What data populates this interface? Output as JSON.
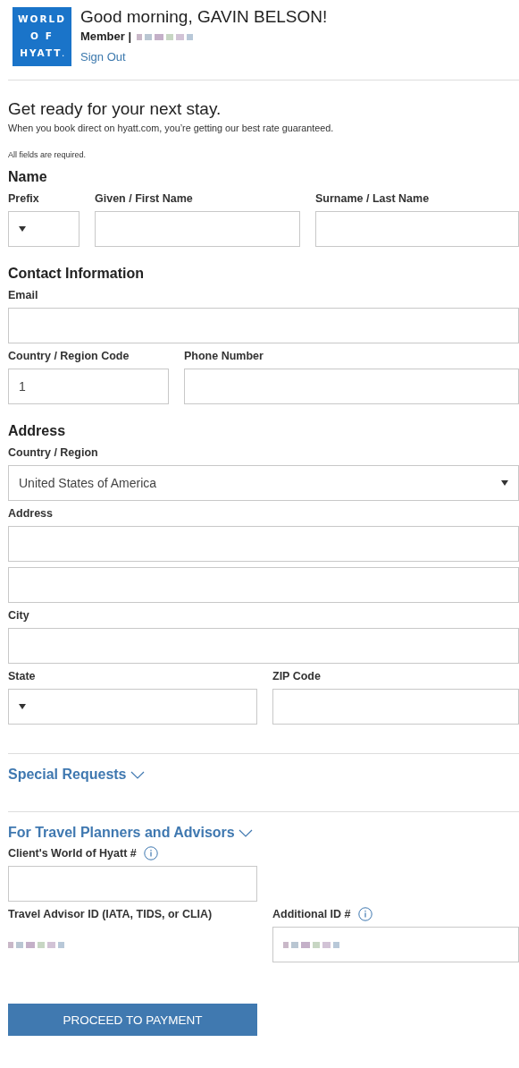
{
  "header": {
    "logo": {
      "lines": [
        "WORLD",
        "O F",
        "HYATT"
      ],
      "mark": "."
    },
    "greeting": "Good morning, GAVIN BELSON!",
    "member_label": "Member |",
    "sign_out": "Sign Out"
  },
  "intro": {
    "title": "Get ready for your next stay.",
    "subtitle": "When you book direct on hyatt.com, you’re getting our best rate guaranteed.",
    "note": "All fields are required."
  },
  "sections": [
    {
      "title": "Name",
      "rows": [
        [
          {
            "label": "Prefix",
            "kind": "select"
          },
          {
            "label": "Given / First Name",
            "kind": "input"
          },
          {
            "label": "Surname / Last Name",
            "kind": "input"
          }
        ]
      ]
    },
    {
      "title": "Contact Information",
      "rows": [
        [
          {
            "label": "Email",
            "kind": "input"
          }
        ],
        [
          {
            "label": "Country / Region Code",
            "kind": "input",
            "value": "1"
          },
          {
            "label": "Phone Number",
            "kind": "input"
          }
        ]
      ]
    },
    {
      "title": "Address",
      "rows": [
        [
          {
            "label": "Country / Region",
            "kind": "select",
            "value": "United States of America"
          }
        ],
        [
          {
            "label": "Address",
            "kind": "input"
          }
        ],
        [
          {
            "kind": "input"
          }
        ],
        [
          {
            "label": "City",
            "kind": "input"
          }
        ],
        [
          {
            "label": "State",
            "kind": "select"
          },
          {
            "label": "ZIP Code",
            "kind": "input"
          }
        ]
      ]
    }
  ],
  "collapsibles": [
    {
      "title": "Special Requests"
    },
    {
      "title": "For Travel Planners and Advisors",
      "rows": [
        [
          {
            "label": "Client's World of Hyatt #",
            "kind": "input",
            "info": true
          }
        ],
        [
          {
            "label": "Travel Advisor ID (IATA, TIDS, or CLIA)",
            "kind": "hidden-value"
          },
          {
            "label": "Additional ID #",
            "kind": "hidden-input",
            "info": true
          }
        ]
      ]
    }
  ],
  "submit": "PROCEED TO PAYMENT"
}
